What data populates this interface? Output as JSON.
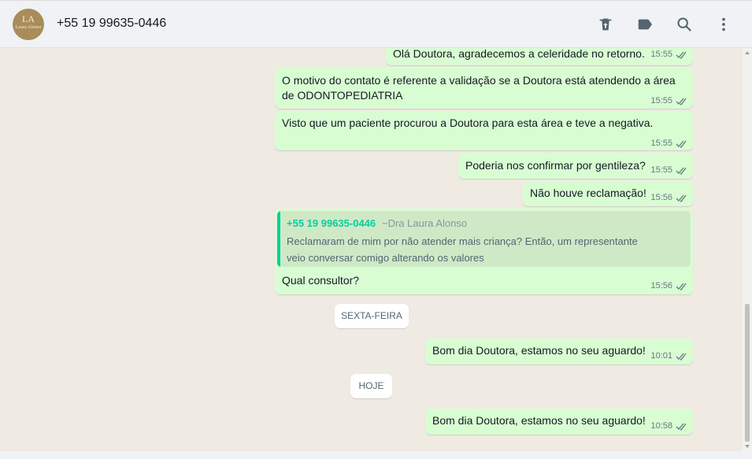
{
  "header": {
    "avatar_brand": "Laura Alonso",
    "avatar_monogram": "LA",
    "contact_name": "+55 19 99635-0446",
    "icons": [
      "delete-icon",
      "label-icon",
      "search-icon",
      "menu-icon"
    ]
  },
  "messages": [
    {
      "text": "Olá Doutora, agradecemos a celeridade no retorno.",
      "time": "15:55"
    },
    {
      "text": "O motivo do contato é referente a validação se a Doutora está atendendo a área de ODONTOPEDIATRIA",
      "time": "15:55"
    },
    {
      "text": "Visto que um paciente procurou a Doutora para esta área e teve a negativa.",
      "time": "15:55"
    },
    {
      "text": "Poderia nos confirmar por gentileza?",
      "time": "15:55"
    },
    {
      "text": "Não houve reclamação!",
      "time": "15:56"
    },
    {
      "quote": {
        "phone": "+55 19 99635-0446",
        "author": "~Dra Laura Alonso",
        "text": "Reclamaram de mim por não atender mais criança? Então, um representante veio conversar comigo alterando os valores"
      },
      "text": "Qual consultor?",
      "time": "15:56"
    },
    {
      "text": "Bom dia Doutora, estamos no seu aguardo!",
      "time": "10:01"
    },
    {
      "text": "Bom dia Doutora, estamos no seu aguardo!",
      "time": "10:58"
    }
  ],
  "day_separators": [
    "SEXTA-FEIRA",
    "HOJE"
  ],
  "colors": {
    "bubble_out": "#d9fdd3",
    "chat_bg": "#efeae2",
    "read_ticks": "#667781",
    "quote_accent": "#06cf9c"
  }
}
